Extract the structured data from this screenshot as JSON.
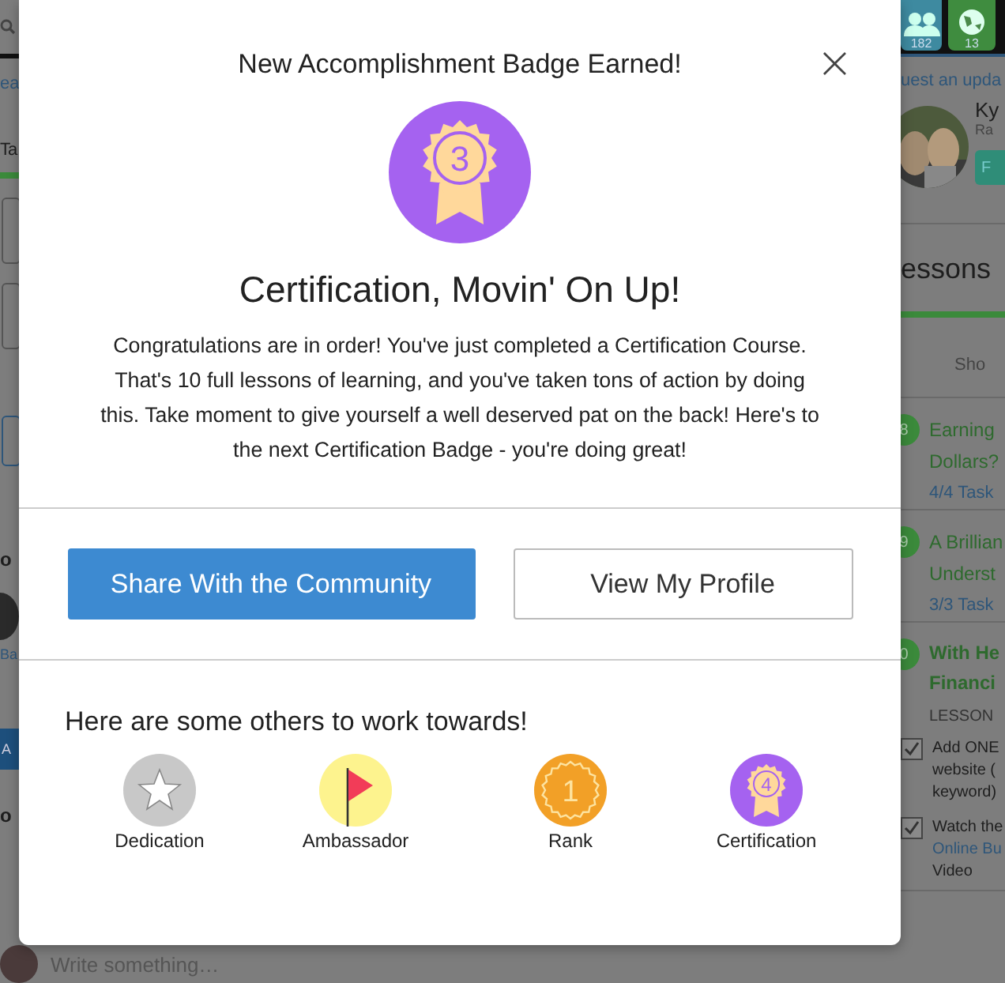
{
  "background": {
    "left": {
      "search_text": "ea",
      "heading": "Ta",
      "section_1": "o",
      "person_name": "Ba",
      "button": "A",
      "section_2": "o",
      "comment_placeholder": "Write something…"
    },
    "right": {
      "counters": [
        {
          "kind": "people",
          "count": "182"
        },
        {
          "kind": "globe",
          "count": "13"
        }
      ],
      "update_link": "uest an upda",
      "user_name": "Ky",
      "user_sub": "Ra",
      "user_button": "F",
      "lessons_heading": "essons",
      "show_link": "Sho",
      "lessons": [
        {
          "number": "8",
          "title": [
            "Earning",
            "Dollars?"
          ],
          "tasks": "4/4 Task",
          "current": false
        },
        {
          "number": "9",
          "title": [
            "A Brillian",
            "Underst"
          ],
          "tasks": "3/3 Task",
          "current": false
        },
        {
          "number": "0",
          "title": [
            "With He",
            "Financi"
          ],
          "label": "LESSON",
          "current": true,
          "items": [
            {
              "checked": true,
              "lines": [
                "Add ONE",
                "website (",
                "keyword)"
              ]
            },
            {
              "checked": true,
              "lines": [
                "Watch the"
              ],
              "link": "Online Bu",
              "after": "Video"
            }
          ]
        }
      ]
    }
  },
  "modal": {
    "title": "New Accomplishment Badge Earned!",
    "close": "×",
    "badge": {
      "kind": "certification",
      "number": "3"
    },
    "heading": "Certification, Movin' On Up!",
    "message": "Congratulations are in order! You've just completed a Certification Course. That's 10 full lessons of learning, and you've taken tons of action by doing this. Take moment to give yourself a well deserved pat on the back! Here's to the next Certification Badge - you're doing great!",
    "buttons": [
      {
        "label": "Share With the Community",
        "kind": "primary"
      },
      {
        "label": "View My Profile",
        "kind": "secondary"
      }
    ],
    "others_title": "Here are some others to work towards!",
    "others": [
      {
        "kind": "star",
        "label": "Dedication"
      },
      {
        "kind": "flag",
        "label": "Ambassador"
      },
      {
        "kind": "rank",
        "number": "1",
        "label": "Rank"
      },
      {
        "kind": "certification",
        "number": "4",
        "label": "Certification"
      }
    ]
  }
}
